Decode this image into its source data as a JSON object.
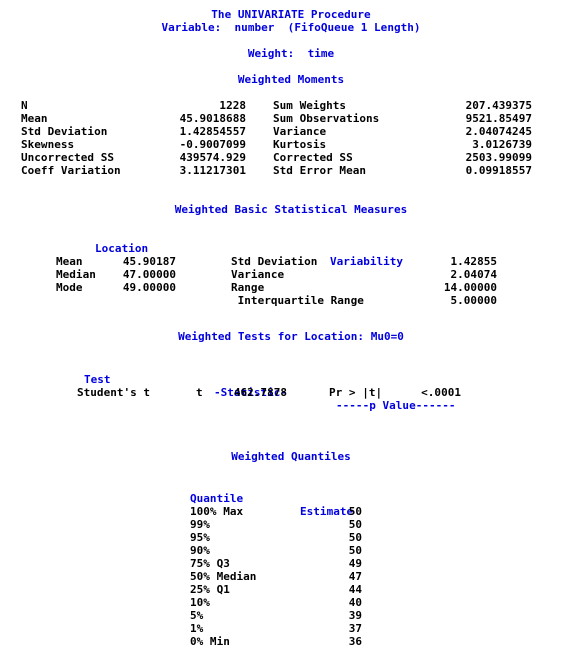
{
  "header": {
    "procedure_title": "The UNIVARIATE Procedure",
    "variable_line": "Variable:  number  (FifoQueue 1 Length)",
    "weight_line": "Weight:  time"
  },
  "moments": {
    "title": "Weighted Moments",
    "rows": [
      {
        "left_label": "N",
        "left_value": "1228",
        "right_label": "Sum Weights",
        "right_value": "207.439375"
      },
      {
        "left_label": "Mean",
        "left_value": "45.9018688",
        "right_label": "Sum Observations",
        "right_value": "9521.85497"
      },
      {
        "left_label": "Std Deviation",
        "left_value": "1.42854557",
        "right_label": "Variance",
        "right_value": "2.04074245"
      },
      {
        "left_label": "Skewness",
        "left_value": "-0.9007099",
        "right_label": "Kurtosis",
        "right_value": "3.0126739"
      },
      {
        "left_label": "Uncorrected SS",
        "left_value": "439574.929",
        "right_label": "Corrected SS",
        "right_value": "2503.99099"
      },
      {
        "left_label": "Coeff Variation",
        "left_value": "3.11217301",
        "right_label": "Std Error Mean",
        "right_value": "0.09918557"
      }
    ]
  },
  "basic_measures": {
    "title": "Weighted Basic Statistical Measures",
    "location_header": "Location",
    "variability_header": "Variability",
    "rows": [
      {
        "loc_label": "Mean",
        "loc_value": "45.90187",
        "var_label": "Std Deviation",
        "var_value": "1.42855"
      },
      {
        "loc_label": "Median",
        "loc_value": "47.00000",
        "var_label": "Variance",
        "var_value": "2.04074"
      },
      {
        "loc_label": "Mode",
        "loc_value": "49.00000",
        "var_label": "Range",
        "var_value": "14.00000"
      },
      {
        "loc_label": "",
        "loc_value": "",
        "var_label": " Interquartile Range",
        "var_value": "5.00000"
      }
    ]
  },
  "tests_location": {
    "title": "Weighted Tests for Location: Mu0=0",
    "col_test": "Test",
    "col_statistic": "-Statistic-",
    "col_pvalue": "-----p Value------",
    "rows": [
      {
        "test": "Student's t",
        "stat_symbol": "t",
        "stat_value": "462.7878",
        "p_label": "Pr > |t|",
        "p_value": "<.0001"
      }
    ]
  },
  "quantiles": {
    "title": "Weighted Quantiles",
    "col_quantile": "Quantile",
    "col_estimate": "Estimate",
    "rows": [
      {
        "quantile": "100% Max",
        "estimate": "50"
      },
      {
        "quantile": "99%",
        "estimate": "50"
      },
      {
        "quantile": "95%",
        "estimate": "50"
      },
      {
        "quantile": "90%",
        "estimate": "50"
      },
      {
        "quantile": "75% Q3",
        "estimate": "49"
      },
      {
        "quantile": "50% Median",
        "estimate": "47"
      },
      {
        "quantile": "25% Q1",
        "estimate": "44"
      },
      {
        "quantile": "10%",
        "estimate": "40"
      },
      {
        "quantile": "5%",
        "estimate": "39"
      },
      {
        "quantile": "1%",
        "estimate": "37"
      },
      {
        "quantile": "0% Min",
        "estimate": "36"
      }
    ]
  },
  "colors": {
    "heading": "#0000e0",
    "body_text": "#000000",
    "background": "#ffffff"
  }
}
